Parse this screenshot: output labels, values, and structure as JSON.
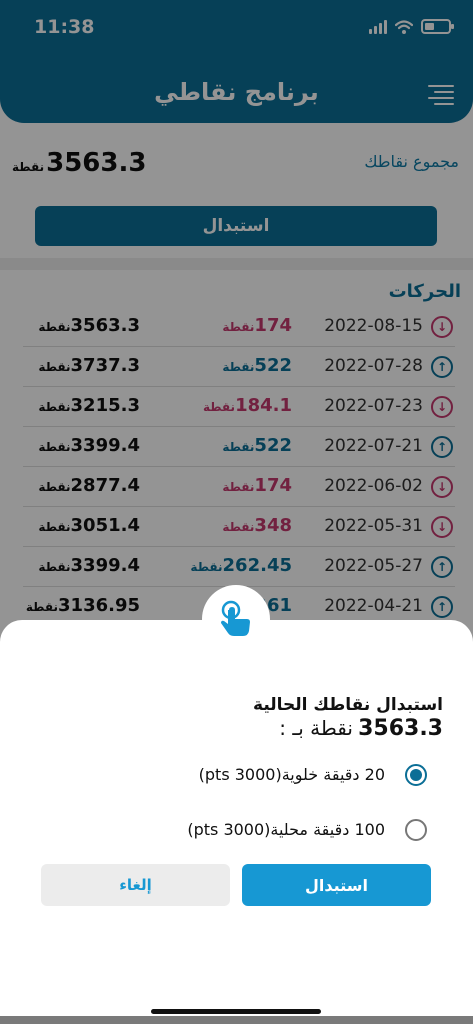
{
  "status_bar": {
    "time": "11:38"
  },
  "header": {
    "title": "برنامج نقاطي",
    "menu_icon": "menu-lines-icon"
  },
  "summary": {
    "label": "مجموع نقاطك",
    "total": "3563.3",
    "unit": "نقطة"
  },
  "redeem_button_label": "استبدال",
  "movements": {
    "title": "الحركات",
    "unit": "نقطة",
    "rows": [
      {
        "direction": "out",
        "date": "2022-08-15",
        "amount": "174",
        "balance": "3563.3"
      },
      {
        "direction": "in",
        "date": "2022-07-28",
        "amount": "522",
        "balance": "3737.3"
      },
      {
        "direction": "out",
        "date": "2022-07-23",
        "amount": "184.1",
        "balance": "3215.3"
      },
      {
        "direction": "in",
        "date": "2022-07-21",
        "amount": "522",
        "balance": "3399.4"
      },
      {
        "direction": "out",
        "date": "2022-06-02",
        "amount": "174",
        "balance": "2877.4"
      },
      {
        "direction": "out",
        "date": "2022-05-31",
        "amount": "348",
        "balance": "3051.4"
      },
      {
        "direction": "in",
        "date": "2022-05-27",
        "amount": "262.45",
        "balance": "3399.4"
      },
      {
        "direction": "in",
        "date": "2022-04-21",
        "amount": "261",
        "balance": "3136.95"
      }
    ]
  },
  "sheet": {
    "badge_icon": "tap-hand-icon",
    "heading": "استبدال نقاطك الحالية",
    "points_value": "3563.3",
    "points_suffix": "نقطة بـ :",
    "options": [
      {
        "label": "20 دقيقة خلوية(3000 pts)",
        "selected": true
      },
      {
        "label": "100 دقيقة محلية(3000 pts)",
        "selected": false
      }
    ],
    "confirm_label": "استبدال",
    "cancel_label": "إلغاء"
  },
  "colors": {
    "primary": "#0b6e96",
    "accent_button": "#1798d3",
    "debit": "#c43a6e"
  }
}
